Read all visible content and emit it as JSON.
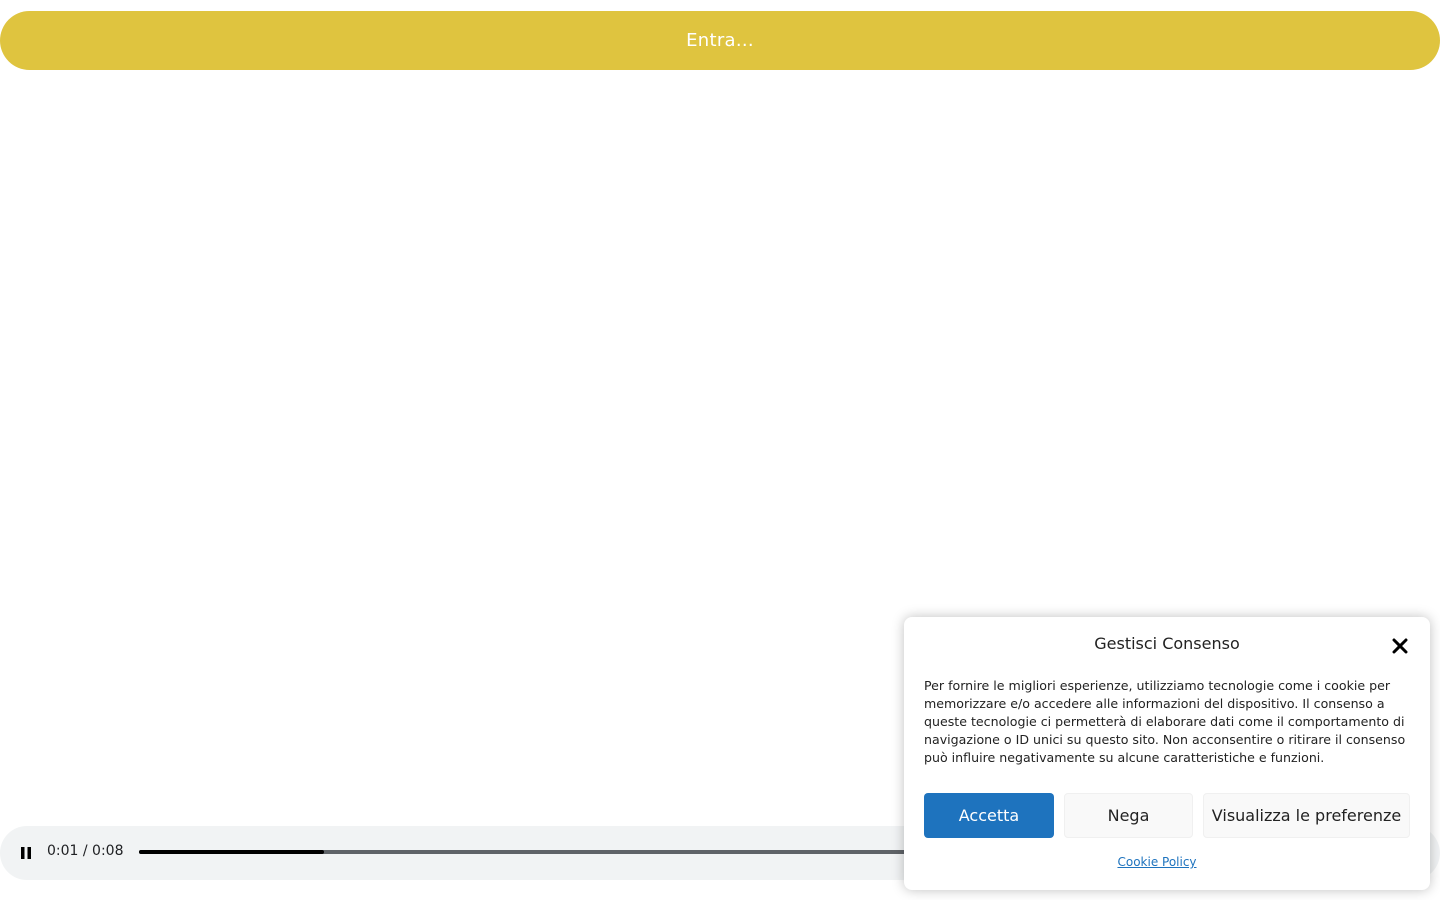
{
  "enter_button": {
    "label": "Entra..."
  },
  "audio_player": {
    "time_text": "0:01 / 0:08",
    "progress_fraction": 0.154
  },
  "cookie_modal": {
    "title": "Gestisci Consenso",
    "body": "Per fornire le migliori esperienze, utilizziamo tecnologie come i cookie per memorizzare e/o accedere alle informazioni del dispositivo. Il consenso a queste tecnologie ci permetterà di elaborare dati come il comportamento di navigazione o ID unici su questo sito. Non acconsentire o ritirare il consenso può influire negativamente su alcune caratteristiche e funzioni.",
    "accept_label": "Accetta",
    "deny_label": "Nega",
    "preferences_label": "Visualizza le preferenze",
    "policy_link": "Cookie Policy"
  },
  "colors": {
    "enter_bar": "#dfc43f",
    "accept_button": "#1e73be",
    "player_background": "#f1f3f4"
  },
  "icons": {
    "pause": "pause-icon",
    "close": "close-icon"
  }
}
